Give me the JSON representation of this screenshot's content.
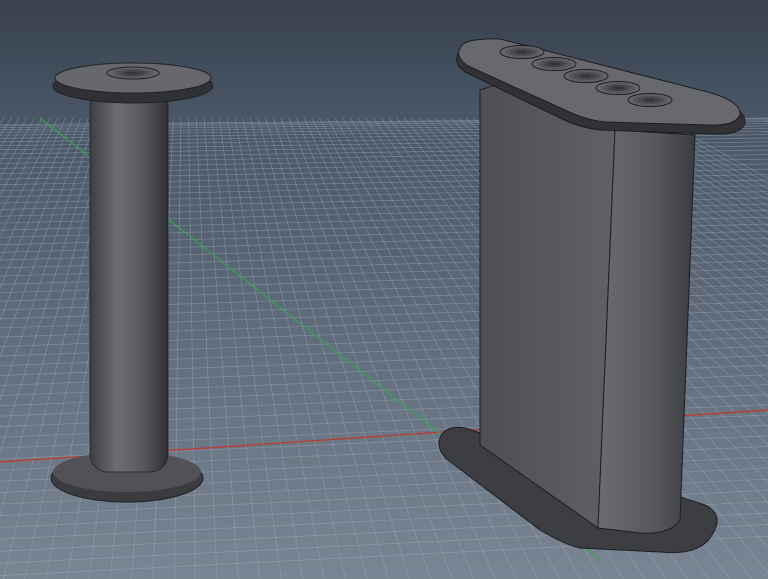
{
  "viewport": {
    "background_top": "#37414f",
    "background_bottom": "#7a8594",
    "grid_color": "#a9b3c2",
    "x_axis_color": "#c0392b",
    "y_axis_color": "#2fa84f",
    "model_color": "#5b5d61"
  },
  "objects": [
    {
      "name": "spool"
    },
    {
      "name": "five-hole-holder"
    }
  ]
}
